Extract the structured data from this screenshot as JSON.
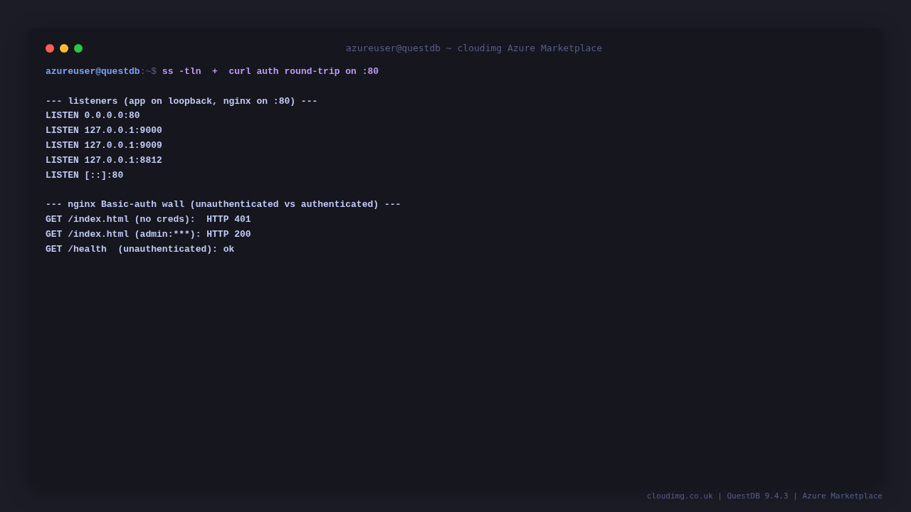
{
  "window": {
    "title": "azureuser@questdb ~ cloudimg Azure Marketplace",
    "controls": [
      {
        "color": "#ff5f57"
      },
      {
        "color": "#febc2e"
      },
      {
        "color": "#28c840"
      }
    ]
  },
  "prompt": {
    "user": "azureuser@questdb",
    "path": ":~$",
    "command": "ss -tln  +  curl auth round-trip on :80"
  },
  "sections": [
    {
      "heading": "--- listeners (app on loopback, nginx on :80) ---",
      "lines": [
        "LISTEN 0.0.0.0:80",
        "LISTEN 127.0.0.1:9000",
        "LISTEN 127.0.0.1:9009",
        "LISTEN 127.0.0.1:8812",
        "LISTEN [::]:80"
      ]
    },
    {
      "heading": "--- nginx Basic-auth wall (unauthenticated vs authenticated) ---",
      "lines": [
        "GET /index.html (no creds):  HTTP 401",
        "GET /index.html (admin:***): HTTP 200",
        "GET /health  (unauthenticated): ok"
      ]
    }
  ],
  "footer": "cloudimg.co.uk | QuestDB 9.4.3 | Azure Marketplace"
}
